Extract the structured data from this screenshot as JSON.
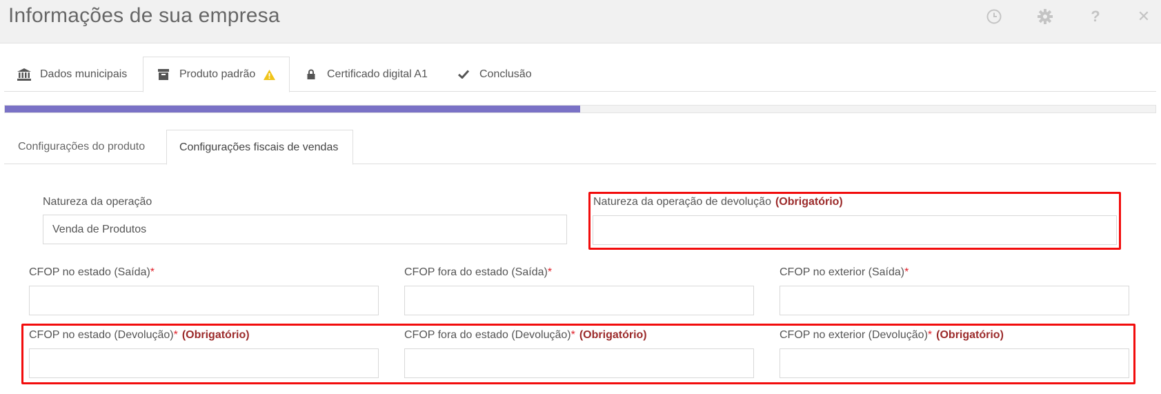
{
  "header": {
    "title": "Informações de sua empresa",
    "icons": [
      "history-icon",
      "gear-icon",
      "help-icon",
      "close-icon"
    ],
    "help_glyph": "?",
    "close_glyph": "✕"
  },
  "tabs": [
    {
      "label": "Dados municipais",
      "icon": "bank-icon"
    },
    {
      "label": "Produto padrão",
      "icon": "archive-icon",
      "warning": "warning-icon"
    },
    {
      "label": "Certificado digital A1",
      "icon": "lock-icon"
    },
    {
      "label": "Conclusão",
      "icon": "check-icon"
    }
  ],
  "progress": {
    "value": 0.5
  },
  "subtabs": [
    {
      "label": "Configurações do produto"
    },
    {
      "label": "Configurações fiscais de vendas"
    }
  ],
  "form": {
    "natureza": {
      "label": "Natureza da operação",
      "value": "Venda de Produtos"
    },
    "natureza_devolucao": {
      "label": "Natureza da operação de devolução",
      "tag": "(Obrigatório)",
      "value": ""
    },
    "cfop_estado_saida": {
      "label": "CFOP no estado (Saída)",
      "star": "*",
      "value": ""
    },
    "cfop_fora_saida": {
      "label": "CFOP fora do estado (Saída)",
      "star": "*",
      "value": ""
    },
    "cfop_exterior_saida": {
      "label": "CFOP no exterior (Saída)",
      "star": "*",
      "value": ""
    },
    "cfop_estado_devolucao": {
      "label": "CFOP no estado (Devolução)",
      "star": "*",
      "tag": "(Obrigatório)",
      "value": ""
    },
    "cfop_fora_devolucao": {
      "label": "CFOP fora do estado (Devolução)",
      "star": "*",
      "tag": "(Obrigatório)",
      "value": ""
    },
    "cfop_exterior_devolucao": {
      "label": "CFOP no exterior (Devolução)",
      "star": "*",
      "tag": "(Obrigatório)",
      "value": ""
    }
  },
  "colors": {
    "progress": "#7a72c6",
    "highlight": "#f20c0c",
    "required_tag": "#9b2a2a",
    "required_star": "#e0202a",
    "warning": "#f0c419"
  }
}
